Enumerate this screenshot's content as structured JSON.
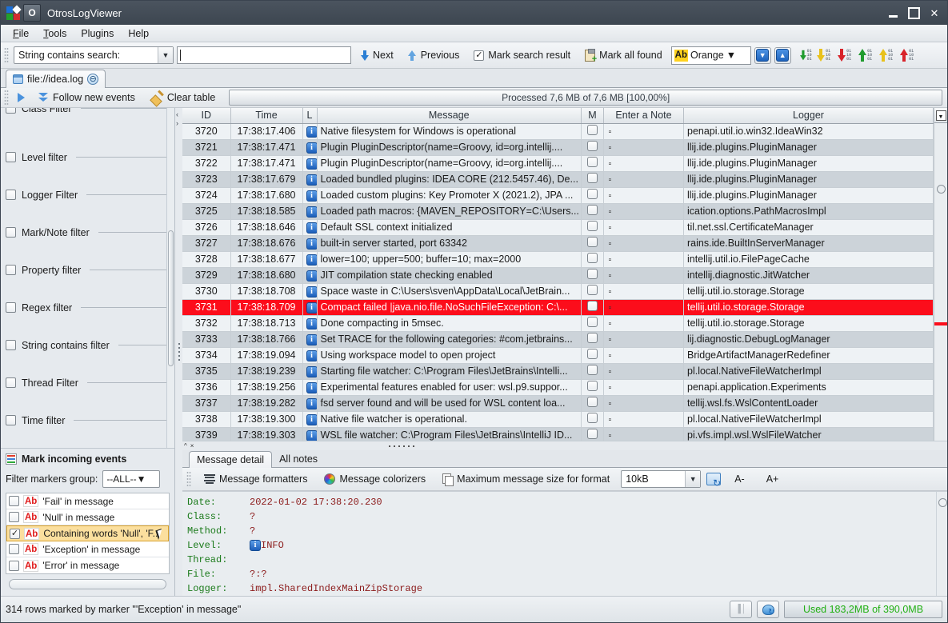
{
  "window": {
    "title": "OtrosLogViewer",
    "app_icon": "otros-logo-icon",
    "buttons": {
      "minimize": "minimize-button",
      "maximize": "maximize-button",
      "close": "✕"
    }
  },
  "menubar": {
    "items": [
      "File",
      "Tools",
      "Plugins",
      "Help"
    ]
  },
  "toolbar": {
    "search_mode": "String contains search:",
    "search_value": "",
    "search_placeholder": "",
    "next_label": "Next",
    "previous_label": "Previous",
    "mark_search_result_label": "Mark search result",
    "mark_search_result_checked": true,
    "mark_all_found_label": "Mark all found",
    "color_chip": "Ab",
    "color_name": "Orange",
    "color_hex": "#ffd21f"
  },
  "filetab": {
    "label": "file://idea.log",
    "close_glyph": "⊖"
  },
  "followbar": {
    "follow_label": "Follow new events",
    "clear_label": "Clear table",
    "progress_text": "Processed 7,6 MB of 7,6 MB [100,00%]"
  },
  "filters": {
    "items": [
      {
        "label": "Class Filter",
        "checked": false
      },
      {
        "label": "Level filter",
        "checked": false
      },
      {
        "label": "Logger Filter",
        "checked": false
      },
      {
        "label": "Mark/Note filter",
        "checked": false
      },
      {
        "label": "Property filter",
        "checked": false
      },
      {
        "label": "Regex filter",
        "checked": false
      },
      {
        "label": "String contains filter",
        "checked": false
      },
      {
        "label": "Thread Filter",
        "checked": false
      },
      {
        "label": "Time filter",
        "checked": false
      }
    ]
  },
  "mark_section": {
    "title": "Mark incoming events",
    "group_label": "Filter markers group:",
    "group_value": "--ALL--",
    "markers": [
      {
        "label": "'Fail' in message",
        "checked": false,
        "chip": "Ab",
        "selected": false
      },
      {
        "label": "'Null' in message",
        "checked": false,
        "chip": "Ab",
        "selected": false
      },
      {
        "label": "Containing words 'Null', 'F...",
        "checked": true,
        "chip": "Ab",
        "selected": true
      },
      {
        "label": "'Exception' in message",
        "checked": false,
        "chip": "Ab",
        "selected": false
      },
      {
        "label": "'Error' in message",
        "checked": false,
        "chip": "Ab",
        "selected": false
      }
    ]
  },
  "table": {
    "columns": [
      "ID",
      "Time",
      "L",
      "Message",
      "M",
      "Enter a Note",
      "Logger"
    ],
    "rows": [
      {
        "id": "3720",
        "time": "17:38:17.406",
        "level": "INFO",
        "message": "Native filesystem for Windows is operational",
        "note": "▫",
        "logger": "penapi.util.io.win32.IdeaWin32",
        "alert": false
      },
      {
        "id": "3721",
        "time": "17:38:17.471",
        "level": "INFO",
        "message": "Plugin PluginDescriptor(name=Groovy, id=org.intellij....",
        "note": "▫",
        "logger": "llij.ide.plugins.PluginManager",
        "alert": false
      },
      {
        "id": "3722",
        "time": "17:38:17.471",
        "level": "INFO",
        "message": "Plugin PluginDescriptor(name=Groovy, id=org.intellij....",
        "note": "▫",
        "logger": "llij.ide.plugins.PluginManager",
        "alert": false
      },
      {
        "id": "3723",
        "time": "17:38:17.679",
        "level": "INFO",
        "message": "Loaded bundled plugins: IDEA CORE (212.5457.46), De...",
        "note": "▫",
        "logger": "llij.ide.plugins.PluginManager",
        "alert": false
      },
      {
        "id": "3724",
        "time": "17:38:17.680",
        "level": "INFO",
        "message": "Loaded custom plugins: Key Promoter X (2021.2), JPA ...",
        "note": "▫",
        "logger": "llij.ide.plugins.PluginManager",
        "alert": false
      },
      {
        "id": "3725",
        "time": "17:38:18.585",
        "level": "INFO",
        "message": "Loaded path macros: {MAVEN_REPOSITORY=C:\\Users...",
        "note": "▫",
        "logger": "ication.options.PathMacrosImpl",
        "alert": false
      },
      {
        "id": "3726",
        "time": "17:38:18.646",
        "level": "INFO",
        "message": "Default SSL context initialized",
        "note": "▫",
        "logger": "til.net.ssl.CertificateManager",
        "alert": false
      },
      {
        "id": "3727",
        "time": "17:38:18.676",
        "level": "INFO",
        "message": "built-in server started, port 63342",
        "note": "▫",
        "logger": "rains.ide.BuiltInServerManager",
        "alert": false
      },
      {
        "id": "3728",
        "time": "17:38:18.677",
        "level": "INFO",
        "message": "lower=100; upper=500; buffer=10; max=2000",
        "note": "▫",
        "logger": "intellij.util.io.FilePageCache",
        "alert": false
      },
      {
        "id": "3729",
        "time": "17:38:18.680",
        "level": "INFO",
        "message": "JIT compilation state checking enabled",
        "note": "▫",
        "logger": "intellij.diagnostic.JitWatcher",
        "alert": false
      },
      {
        "id": "3730",
        "time": "17:38:18.708",
        "level": "INFO",
        "message": "Space waste in C:\\Users\\sven\\AppData\\Local\\JetBrain...",
        "note": "▫",
        "logger": "tellij.util.io.storage.Storage",
        "alert": false
      },
      {
        "id": "3731",
        "time": "17:38:18.709",
        "level": "INFO",
        "message": "Compact failed |java.nio.file.NoSuchFileException: C:\\...",
        "note": "▫",
        "logger": "tellij.util.io.storage.Storage",
        "alert": true
      },
      {
        "id": "3732",
        "time": "17:38:18.713",
        "level": "INFO",
        "message": "Done compacting in 5msec.",
        "note": "▫",
        "logger": "tellij.util.io.storage.Storage",
        "alert": false
      },
      {
        "id": "3733",
        "time": "17:38:18.766",
        "level": "INFO",
        "message": "Set TRACE for the following categories: #com.jetbrains...",
        "note": "▫",
        "logger": "lij.diagnostic.DebugLogManager",
        "alert": false
      },
      {
        "id": "3734",
        "time": "17:38:19.094",
        "level": "INFO",
        "message": "Using workspace model to open project",
        "note": "▫",
        "logger": "BridgeArtifactManagerRedefiner",
        "alert": false
      },
      {
        "id": "3735",
        "time": "17:38:19.239",
        "level": "INFO",
        "message": "Starting file watcher: C:\\Program Files\\JetBrains\\Intelli...",
        "note": "▫",
        "logger": "pl.local.NativeFileWatcherImpl",
        "alert": false
      },
      {
        "id": "3736",
        "time": "17:38:19.256",
        "level": "INFO",
        "message": "Experimental features enabled for user: wsl.p9.suppor...",
        "note": "▫",
        "logger": "penapi.application.Experiments",
        "alert": false
      },
      {
        "id": "3737",
        "time": "17:38:19.282",
        "level": "INFO",
        "message": "fsd server found and will be used for WSL content loa...",
        "note": "▫",
        "logger": "tellij.wsl.fs.WslContentLoader",
        "alert": false
      },
      {
        "id": "3738",
        "time": "17:38:19.300",
        "level": "INFO",
        "message": "Native file watcher is operational.",
        "note": "▫",
        "logger": "pl.local.NativeFileWatcherImpl",
        "alert": false
      },
      {
        "id": "3739",
        "time": "17:38:19.303",
        "level": "INFO",
        "message": "WSL file watcher: C:\\Program Files\\JetBrains\\IntelliJ ID...",
        "note": "▫",
        "logger": "pi.vfs.impl.wsl.WslFileWatcher",
        "alert": false
      }
    ]
  },
  "detail": {
    "tabs": [
      {
        "label": "Message detail",
        "active": true
      },
      {
        "label": "All notes",
        "active": false
      }
    ],
    "toolbar": {
      "formatters_label": "Message formatters",
      "colorizers_label": "Message colorizers",
      "max_size_label": "Maximum message size for format",
      "max_size_value": "10kB",
      "font_smaller": "A-",
      "font_bigger": "A+"
    },
    "fields": [
      {
        "key": "Date:",
        "value": "2022-01-02 17:38:20.230",
        "icon": ""
      },
      {
        "key": "Class:",
        "value": "?",
        "icon": ""
      },
      {
        "key": "Method:",
        "value": "?",
        "icon": ""
      },
      {
        "key": "Level:",
        "value": "INFO",
        "icon": "info-icon"
      },
      {
        "key": "Thread:",
        "value": "",
        "icon": ""
      },
      {
        "key": "File:",
        "value": "?:?",
        "icon": ""
      },
      {
        "key": "Logger:",
        "value": "impl.SharedIndexMainZipStorage",
        "icon": ""
      }
    ]
  },
  "statusbar": {
    "text": "314 rows marked by marker \"'Exception' in message\"",
    "memory_text": "Used 183,2MB of 390,0MB",
    "memory_color": "#22b014"
  }
}
